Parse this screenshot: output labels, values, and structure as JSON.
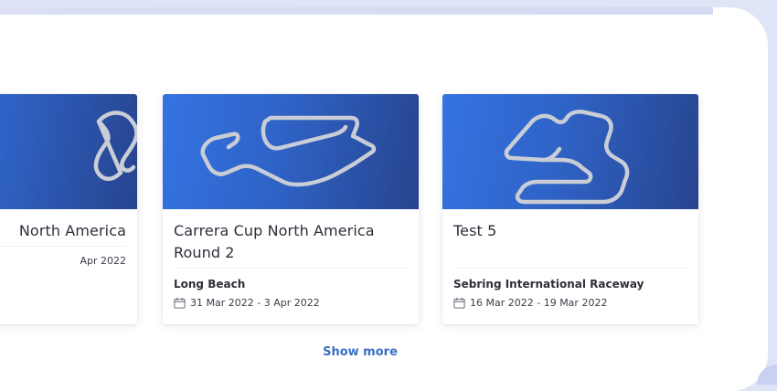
{
  "cards": [
    {
      "title": "North America",
      "location": "",
      "dates": "Apr 2022",
      "track_icon": "track-layout-icon"
    },
    {
      "title": "Carrera Cup North America Round 2",
      "location": "Long Beach",
      "dates": "31 Mar 2022 - 3 Apr 2022",
      "track_icon": "long-beach-track-icon"
    },
    {
      "title": "Test 5",
      "location": "Sebring International Raceway",
      "dates": "16 Mar 2022 - 19 Mar 2022",
      "track_icon": "sebring-track-icon"
    }
  ],
  "show_more_label": "Show more",
  "colors": {
    "card_gradient_start": "#3473e2",
    "card_gradient_end": "#27448e",
    "link": "#3a6fc4",
    "page_background": "#dfe4f6"
  }
}
